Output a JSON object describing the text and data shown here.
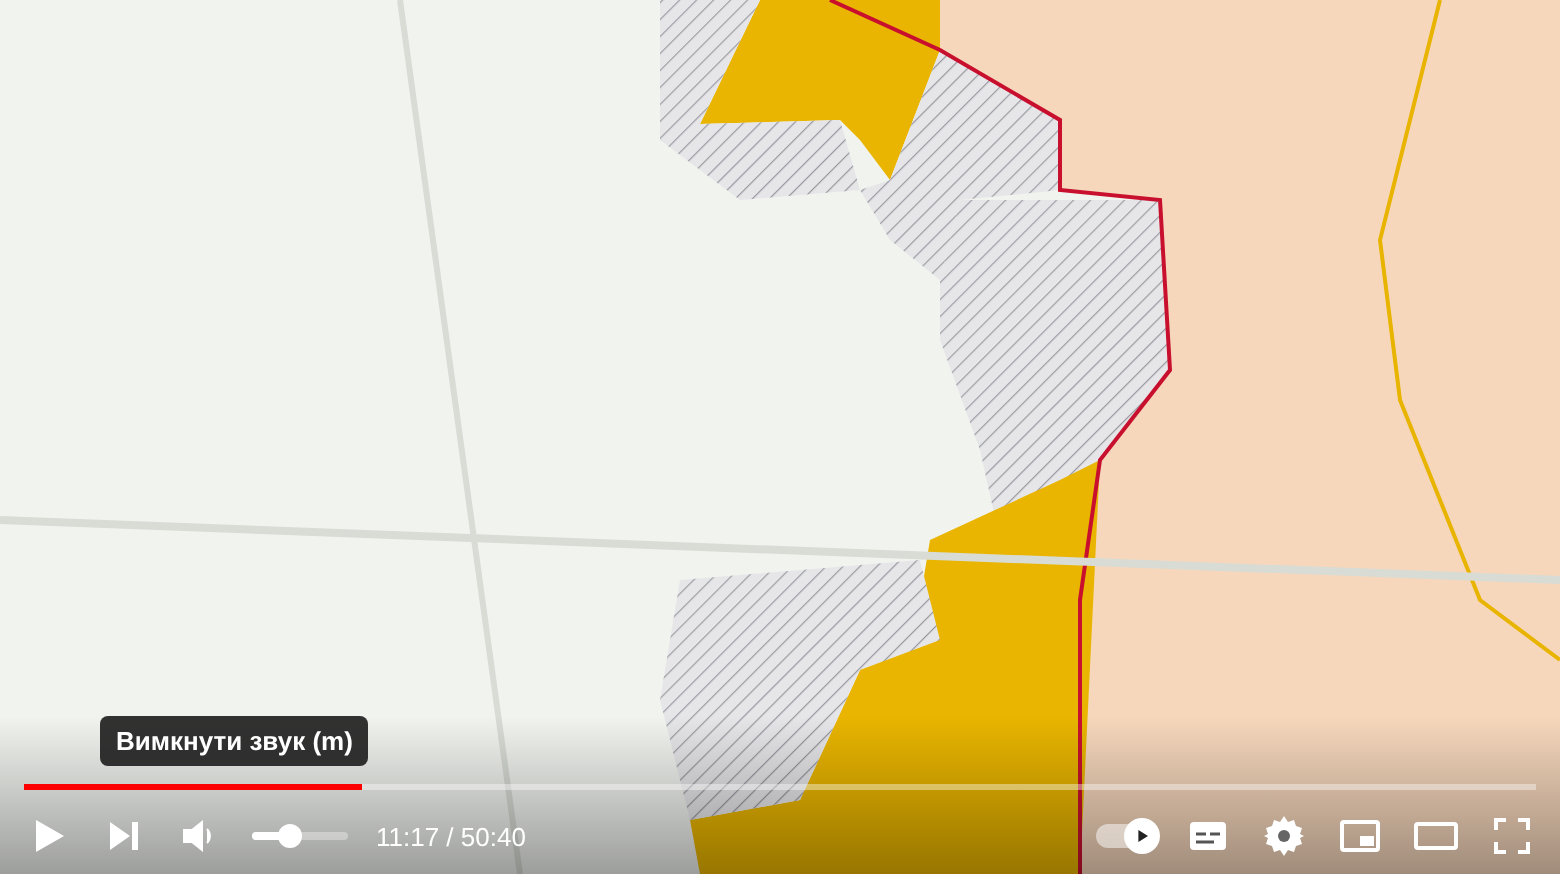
{
  "player": {
    "tooltip": "Вимкнути звук (m)",
    "progress": {
      "level": 0.223
    },
    "volume": {
      "level": 0.4
    },
    "time": "11:17 / 50:40",
    "autoplay": {
      "on": true
    }
  }
}
